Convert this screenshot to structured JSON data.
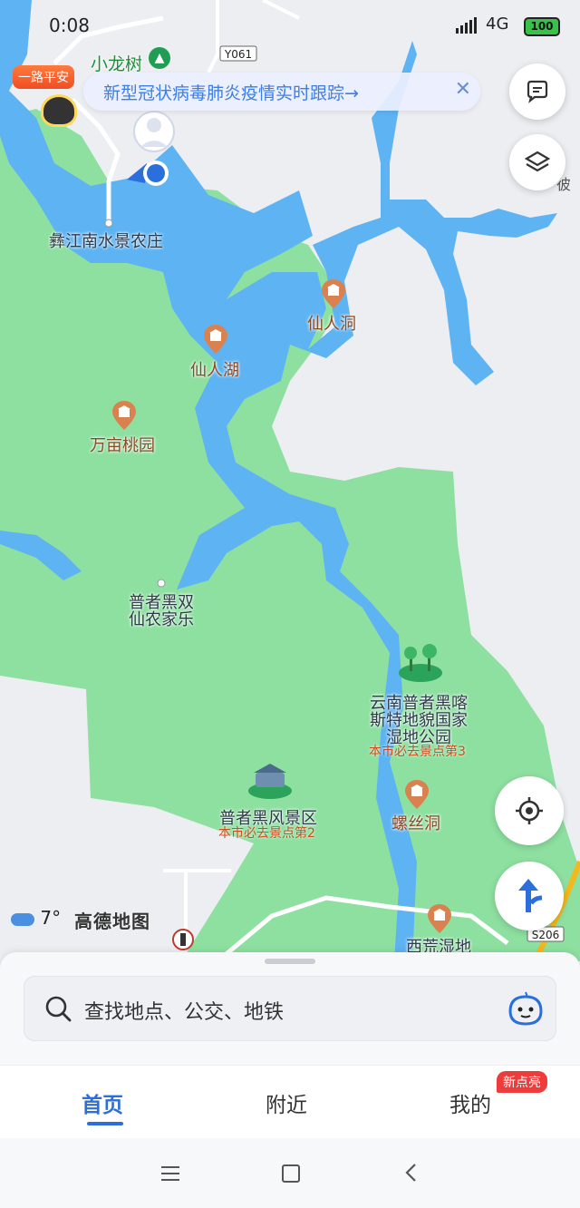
{
  "status_bar": {
    "time": "0:08",
    "network": "4G",
    "battery": "100"
  },
  "road_labels": {
    "y061": "Y061",
    "s206": "S206"
  },
  "banner": {
    "text": "新型冠状病毒肺炎疫情实时跟踪→",
    "close": "✕"
  },
  "tag_badge": "一路平安",
  "map_labels": {
    "xiaolongshu": "小龙树",
    "yijiang": "彝江南水景农庄",
    "heishuang_1": "普者黑双",
    "heishuang_2": "仙农家乐",
    "bo": "彼"
  },
  "pois": {
    "xianrendong": "仙人洞",
    "xianrenhu": "仙人湖",
    "wanmu": "万亩桃园",
    "wetland_1": "云南普者黑喀",
    "wetland_2": "斯特地貌国家",
    "wetland_3": "湿地公园",
    "wetland_rank": "本市必去景点第3",
    "fengjing": "普者黑风景区",
    "fengjing_rank": "本市必去景点第2",
    "luosi": "螺丝洞",
    "xihuang": "西荒湿地"
  },
  "weather": {
    "icon": "cloud-icon",
    "temp": "7°"
  },
  "map_logo": "高德地图",
  "search": {
    "placeholder": "查找地点、公交、地铁"
  },
  "tabs": {
    "home": "首页",
    "nearby": "附近",
    "mine": "我的",
    "badge": "新点亮"
  },
  "colors": {
    "land": "#8ee0a1",
    "water": "#5eb3f3",
    "base": "#eceef2",
    "accent": "#2a6fdb",
    "poi": "#d9824f"
  }
}
